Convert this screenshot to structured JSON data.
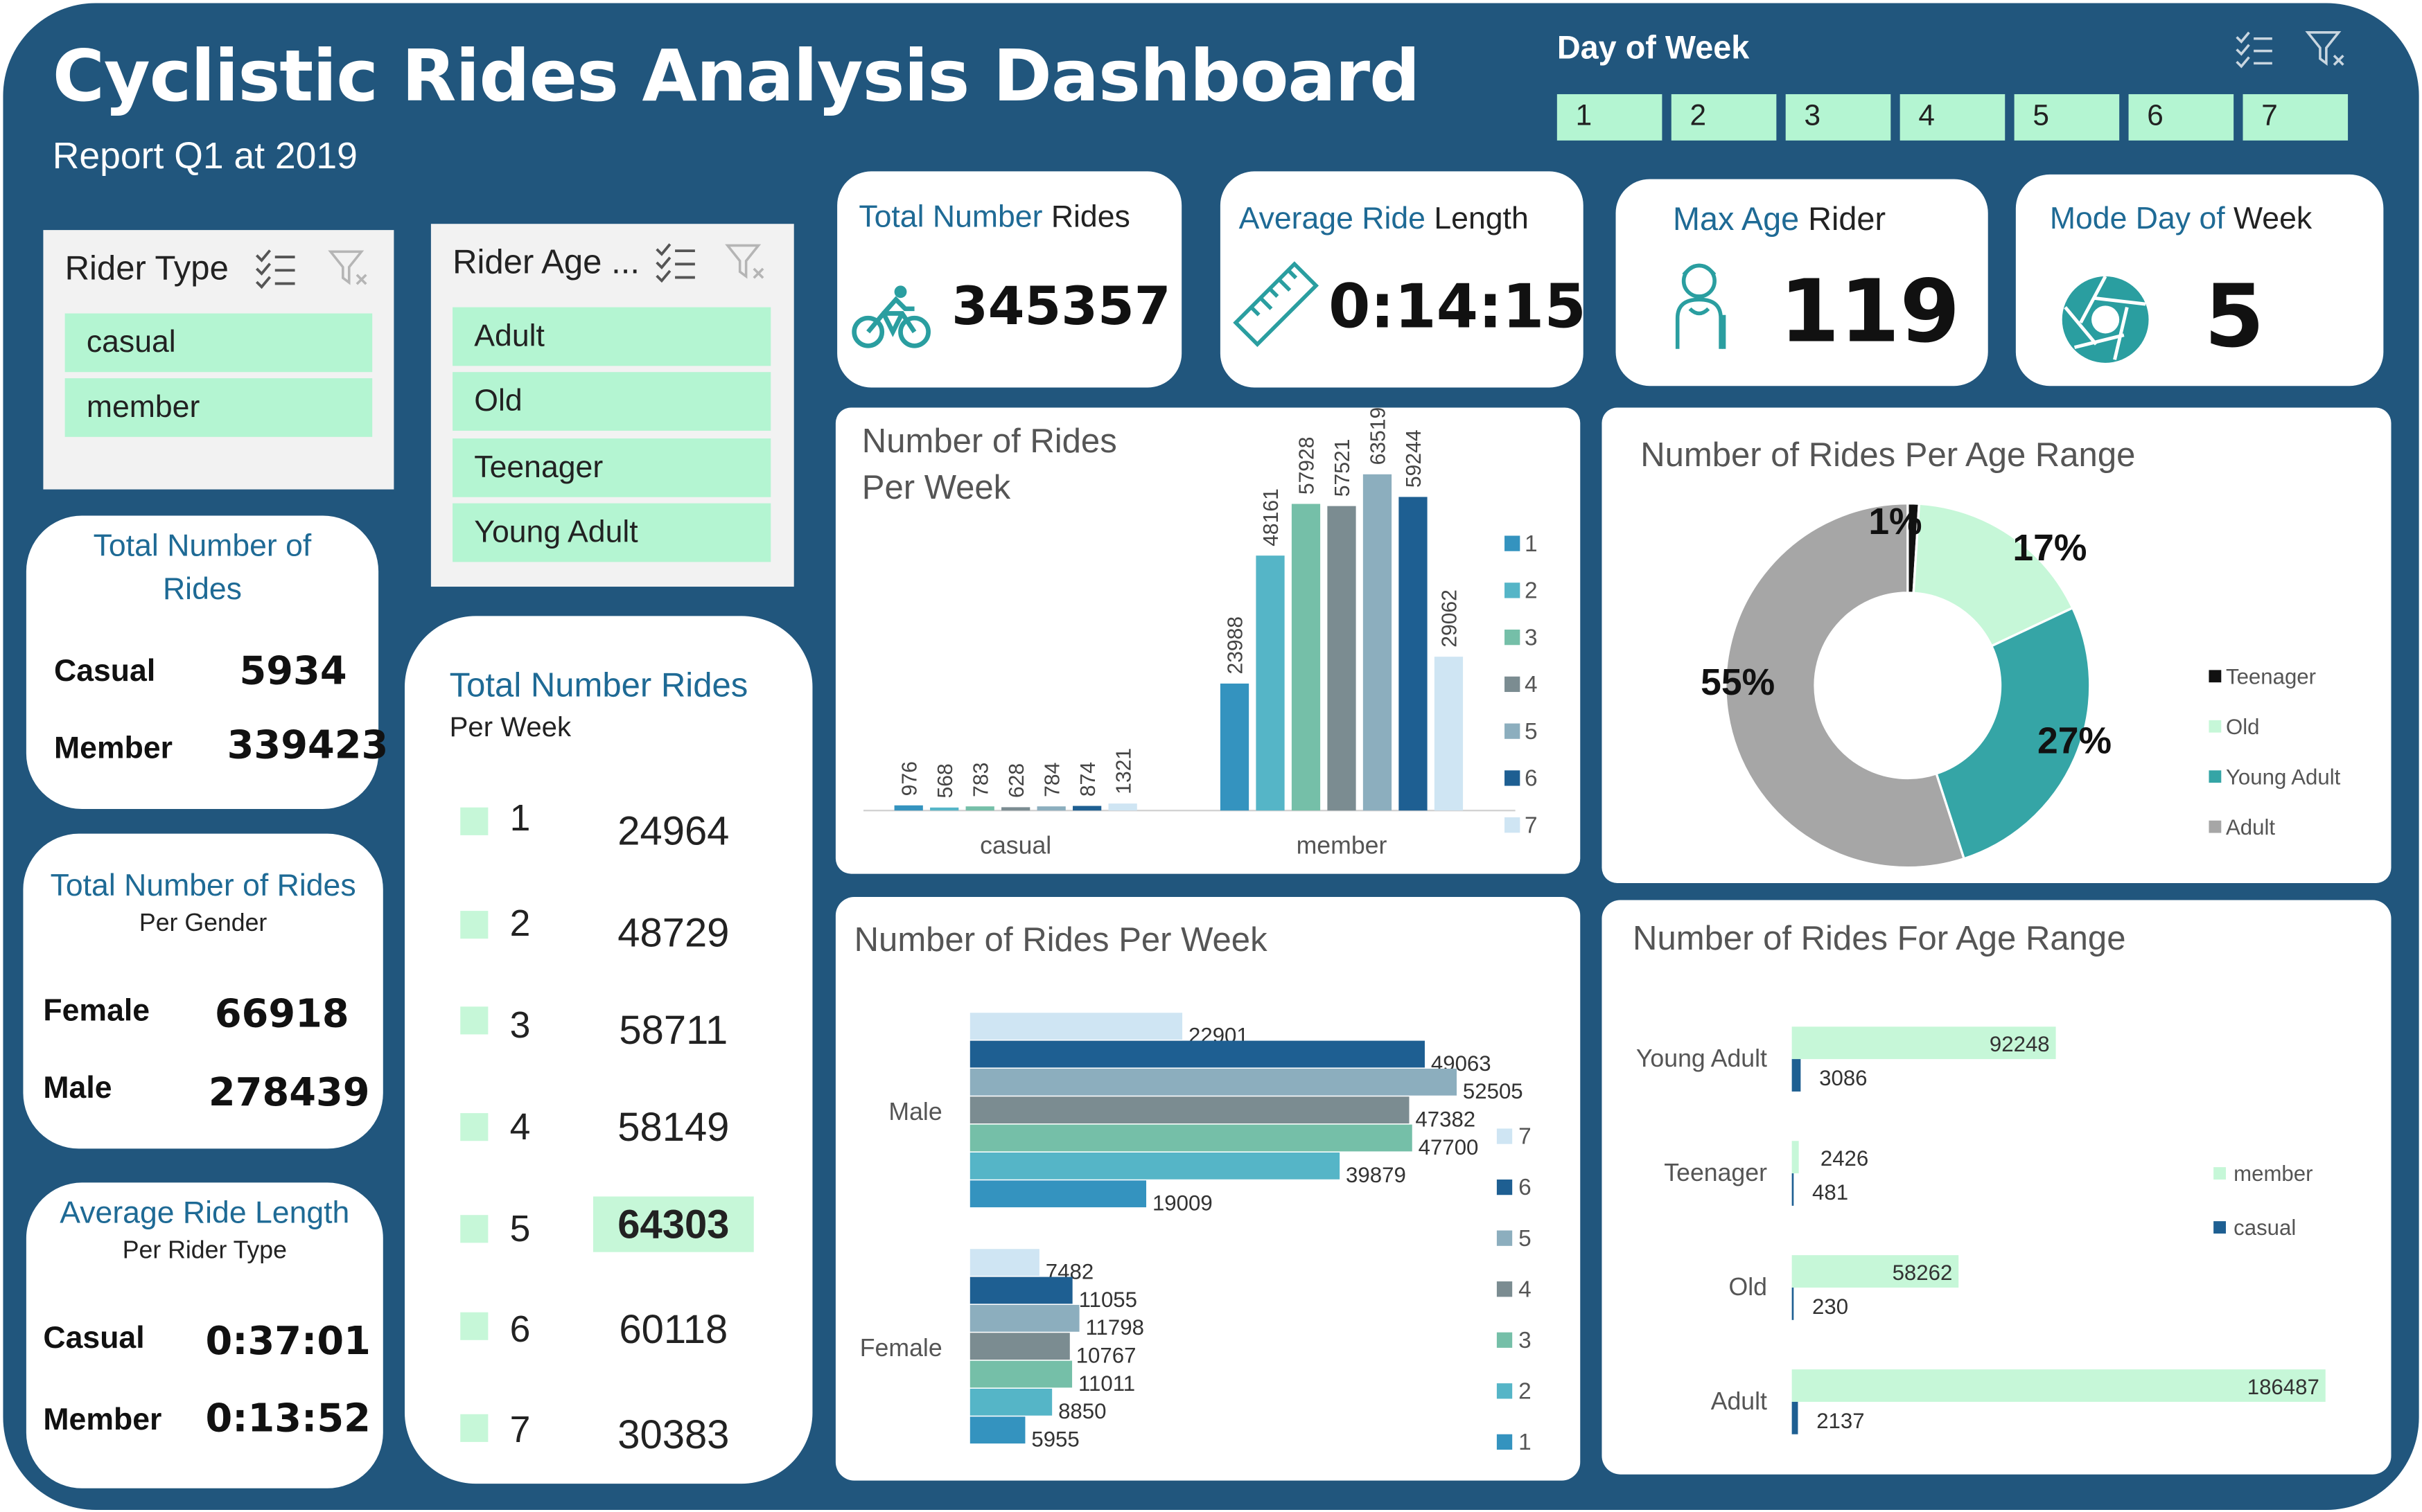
{
  "header": {
    "title": "Cyclistic Rides Analysis Dashboard",
    "subtitle": "Report Q1 at 2019"
  },
  "day_of_week_slicer": {
    "title": "Day of Week",
    "options": [
      "1",
      "2",
      "3",
      "4",
      "5",
      "6",
      "7"
    ]
  },
  "rider_type_slicer": {
    "title": "Rider Type",
    "options": [
      "casual",
      "member"
    ]
  },
  "rider_age_slicer": {
    "title": "Rider Age ...",
    "options": [
      "Adult",
      "Old",
      "Teenager",
      "Young Adult"
    ]
  },
  "kpis": {
    "total_rides": {
      "title_a": "Total Number ",
      "title_b": "Rides",
      "value": "345357",
      "icon": "bicycle-icon"
    },
    "avg_length": {
      "title_a": "Average Ride ",
      "title_b": "Length",
      "value": "0:14:15",
      "icon": "ruler-icon"
    },
    "max_age": {
      "title_a": "Max Age ",
      "title_b": "Rider",
      "value": "119",
      "icon": "old-man-icon"
    },
    "mode_day": {
      "title_a": "Mode Day of ",
      "title_b": "Week",
      "value": "5",
      "icon": "aperture-icon"
    }
  },
  "total_rides_card": {
    "title": "Total Number of Rides",
    "rows": [
      {
        "label": "Casual",
        "value": "5934"
      },
      {
        "label": "Member",
        "value": "339423"
      }
    ]
  },
  "gender_card": {
    "title": "Total Number of Rides",
    "subtitle": "Per Gender",
    "rows": [
      {
        "label": "Female",
        "value": "66918"
      },
      {
        "label": "Male",
        "value": "278439"
      }
    ]
  },
  "avg_length_card": {
    "title": "Average Ride Length",
    "subtitle": "Per Rider Type",
    "rows": [
      {
        "label": "Casual",
        "value": "0:37:01"
      },
      {
        "label": "Member",
        "value": "0:13:52"
      }
    ]
  },
  "week_card": {
    "title": "Total Number Rides",
    "subtitle": "Per Week",
    "rows": [
      {
        "day": "1",
        "value": "24964"
      },
      {
        "day": "2",
        "value": "48729"
      },
      {
        "day": "3",
        "value": "58711"
      },
      {
        "day": "4",
        "value": "58149"
      },
      {
        "day": "5",
        "value": "64303"
      },
      {
        "day": "6",
        "value": "60118"
      },
      {
        "day": "7",
        "value": "30383"
      }
    ]
  },
  "colors": {
    "background": "#21567d",
    "slicer_item": "#b4f5d2",
    "day_series": [
      "#3493bf",
      "#55b5c7",
      "#75bfa8",
      "#7b8c91",
      "#8caebe",
      "#1e5f92",
      "#cfe5f3"
    ],
    "age_member": "#c6f7d8",
    "age_casual": "#1e5f92"
  },
  "charts": {
    "weekly_column_title_l1": "Number of Rides",
    "weekly_column_title_l2": "Per Week",
    "age_donut_title": "Number of Rides Per Age Range",
    "gender_bar_title": "Number of Rides Per Week",
    "age_bar_title": "Number of Rides For Age Range"
  },
  "chart_data": [
    {
      "type": "bar",
      "orientation": "vertical",
      "title": "Number of Rides Per Week",
      "categories": [
        "casual",
        "member"
      ],
      "series": [
        {
          "name": "1",
          "values": [
            976,
            23988
          ]
        },
        {
          "name": "2",
          "values": [
            568,
            48161
          ]
        },
        {
          "name": "3",
          "values": [
            783,
            57928
          ]
        },
        {
          "name": "4",
          "values": [
            628,
            57521
          ]
        },
        {
          "name": "5",
          "values": [
            784,
            63519
          ]
        },
        {
          "name": "6",
          "values": [
            874,
            59244
          ]
        },
        {
          "name": "7",
          "values": [
            1321,
            29062
          ]
        }
      ],
      "ylim": [
        0,
        70000
      ],
      "legend": "right",
      "data_labels": true,
      "grid": false
    },
    {
      "type": "pie",
      "variant": "donut",
      "title": "Number of Rides Per Age Range",
      "labels": [
        "Teenager",
        "Old",
        "Young Adult",
        "Adult"
      ],
      "values": [
        1,
        17,
        27,
        55
      ],
      "value_labels": [
        "1%",
        "17%",
        "27%",
        "55%"
      ],
      "colors": [
        "#111111",
        "#c6f7d8",
        "#35a5a6",
        "#a6a6a6"
      ],
      "legend": "right"
    },
    {
      "type": "bar",
      "orientation": "horizontal",
      "title": "Number of Rides Per Week",
      "categories": [
        "Male",
        "Female"
      ],
      "series": [
        {
          "name": "7",
          "values": [
            22901,
            7482
          ]
        },
        {
          "name": "6",
          "values": [
            49063,
            11055
          ]
        },
        {
          "name": "5",
          "values": [
            52505,
            11798
          ]
        },
        {
          "name": "4",
          "values": [
            47382,
            10767
          ]
        },
        {
          "name": "3",
          "values": [
            47700,
            11011
          ]
        },
        {
          "name": "2",
          "values": [
            39879,
            8850
          ]
        },
        {
          "name": "1",
          "values": [
            19009,
            5955
          ]
        }
      ],
      "xlim": [
        0,
        55000
      ],
      "legend": "right",
      "data_labels": true,
      "grid": false
    },
    {
      "type": "bar",
      "orientation": "horizontal",
      "title": "Number of Rides For Age Range",
      "categories": [
        "Young Adult",
        "Teenager",
        "Old",
        "Adult"
      ],
      "series": [
        {
          "name": "member",
          "values": [
            92248,
            2426,
            58262,
            186487
          ]
        },
        {
          "name": "casual",
          "values": [
            3086,
            481,
            230,
            2137
          ]
        }
      ],
      "xlim": [
        0,
        190000
      ],
      "legend": "right",
      "data_labels": true,
      "grid": false
    }
  ]
}
